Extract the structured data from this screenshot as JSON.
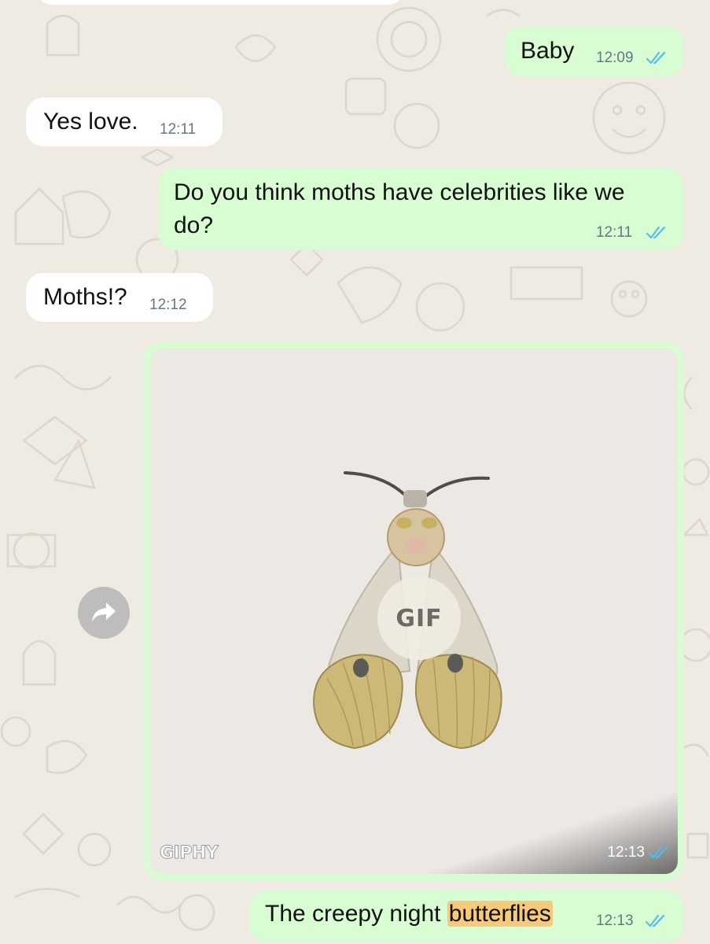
{
  "messages": [
    {
      "direction": "out",
      "text": "Baby",
      "time": "12:09",
      "status": "read"
    },
    {
      "direction": "in",
      "text": "Yes love.",
      "time": "12:11"
    },
    {
      "direction": "out",
      "text_line1": "Do you think moths have celebrities like we",
      "text_line2": "do?",
      "time": "12:11",
      "status": "read"
    },
    {
      "direction": "in",
      "text": "Moths!?",
      "time": "12:12"
    },
    {
      "direction": "out",
      "type": "gif",
      "badge": "GIF",
      "source_label": "GIPHY",
      "time": "12:13",
      "status": "read"
    },
    {
      "direction": "out",
      "text_before": "The creepy night ",
      "text_highlight": "butterflies",
      "time": "12:13",
      "status": "read"
    }
  ],
  "icons": {
    "read_receipt": "double-check-icon",
    "forward": "forward-arrow-icon"
  },
  "colors": {
    "wallpaper": "#efeae2",
    "incoming_bubble": "#ffffff",
    "outgoing_bubble": "#d9fdd3",
    "read_tick": "#53bdeb",
    "search_highlight": "#f7c97a"
  }
}
